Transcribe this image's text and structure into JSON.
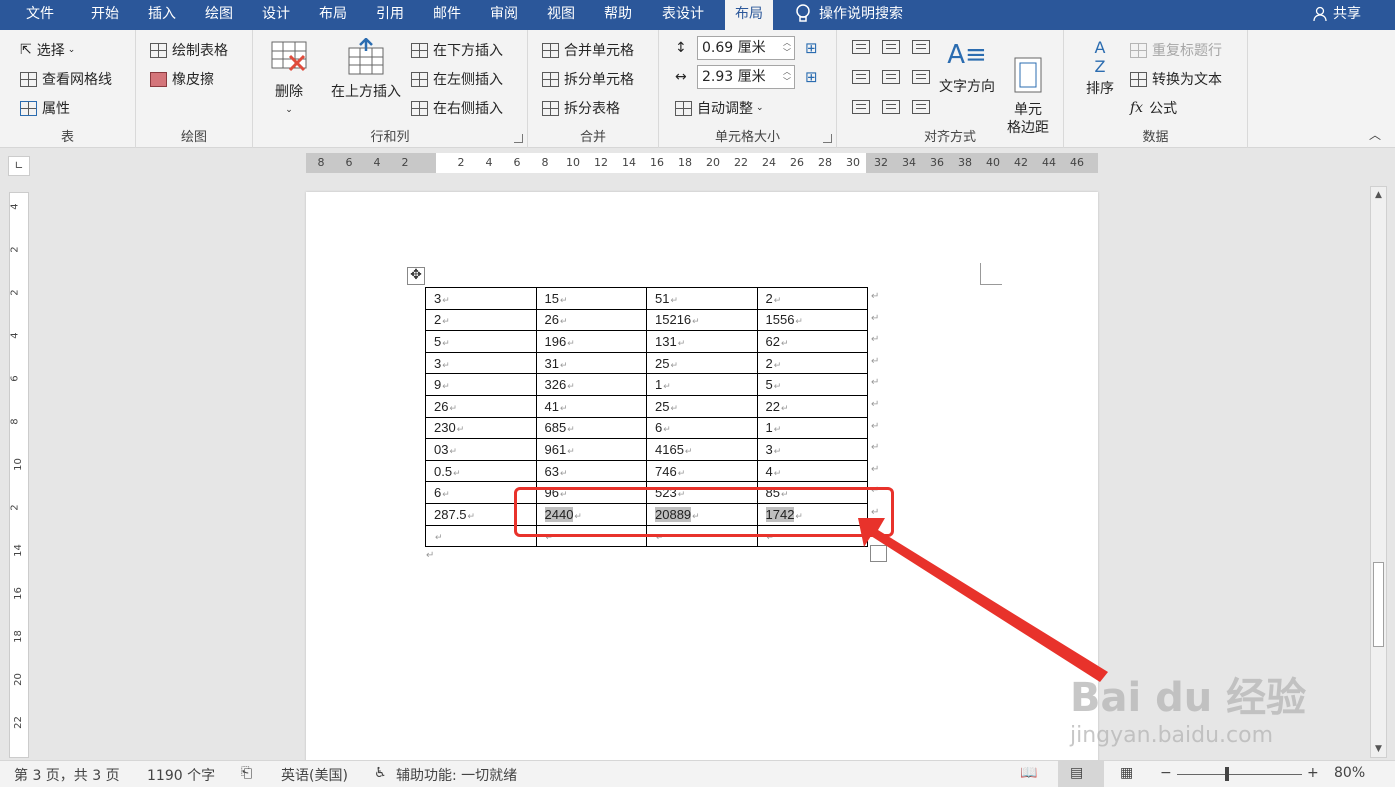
{
  "tabs": [
    {
      "label": "文件",
      "active": false
    },
    {
      "label": "开始",
      "active": false
    },
    {
      "label": "插入",
      "active": false
    },
    {
      "label": "绘图",
      "active": false
    },
    {
      "label": "设计",
      "active": false
    },
    {
      "label": "布局",
      "active": false
    },
    {
      "label": "引用",
      "active": false
    },
    {
      "label": "邮件",
      "active": false
    },
    {
      "label": "审阅",
      "active": false
    },
    {
      "label": "视图",
      "active": false
    },
    {
      "label": "帮助",
      "active": false
    },
    {
      "label": "表设计",
      "active": false
    },
    {
      "label": "布局",
      "active": true
    }
  ],
  "tell_me": "操作说明搜索",
  "share": "共享",
  "ribbon": {
    "table": {
      "label": "表",
      "select": "选择",
      "view_gridlines": "查看网格线",
      "properties": "属性"
    },
    "draw": {
      "label": "绘图",
      "draw_table": "绘制表格",
      "eraser": "橡皮擦"
    },
    "rows_cols": {
      "label": "行和列",
      "delete": "删除",
      "insert_above": "在上方插入",
      "insert_below": "在下方插入",
      "insert_left": "在左侧插入",
      "insert_right": "在右侧插入"
    },
    "merge": {
      "label": "合并",
      "merge_cells": "合并单元格",
      "split_cells": "拆分单元格",
      "split_table": "拆分表格"
    },
    "cell_size": {
      "label": "单元格大小",
      "height": "0.69 厘米",
      "width": "2.93 厘米",
      "autofit": "自动调整"
    },
    "alignment": {
      "label": "对齐方式",
      "text_direction": "文字方向",
      "cell_margins": "单元\n格边距"
    },
    "data": {
      "label": "数据",
      "sort": "排序",
      "repeat_header": "重复标题行",
      "convert_to_text": "转换为文本",
      "formula": "公式"
    }
  },
  "ruler": {
    "h_numbers": [
      "8",
      "6",
      "4",
      "2",
      "2",
      "4",
      "6",
      "8",
      "10",
      "12",
      "14",
      "16",
      "18",
      "20",
      "22",
      "24",
      "26",
      "28",
      "30",
      "32",
      "34",
      "36",
      "38",
      "40",
      "42",
      "44",
      "46"
    ],
    "v_numbers": [
      "4",
      "2",
      "2",
      "4",
      "6",
      "8",
      "10",
      "2",
      "14",
      "16",
      "18",
      "20",
      "22"
    ]
  },
  "table_rows": [
    [
      "3",
      "15",
      "51",
      "2"
    ],
    [
      "2",
      "26",
      "15216",
      "1556"
    ],
    [
      "5",
      "196",
      "131",
      "62"
    ],
    [
      "3",
      "31",
      "25",
      "2"
    ],
    [
      "9",
      "326",
      "1",
      "5"
    ],
    [
      "26",
      "41",
      "25",
      "22"
    ],
    [
      "230",
      "685",
      "6",
      "1"
    ],
    [
      "03",
      "961",
      "4165",
      "3"
    ],
    [
      "0.5",
      "63",
      "746",
      "4"
    ],
    [
      "6",
      "96",
      "523",
      "85"
    ],
    [
      "287.5",
      "2440",
      "20889",
      "1742"
    ],
    [
      "",
      "",
      "",
      ""
    ]
  ],
  "selected_row_index": 10,
  "watermark": {
    "brand": "Bai du 经验",
    "url": "jingyan.baidu.com"
  },
  "status": {
    "page": "第 3 页，共 3 页",
    "words": "1190 个字",
    "language": "英语(美国)",
    "accessibility": "辅助功能: 一切就绪",
    "zoom": "80%"
  },
  "colors": {
    "brand": "#2b579a",
    "annotation": "#e8322b",
    "selection": "#bfbfbf"
  }
}
